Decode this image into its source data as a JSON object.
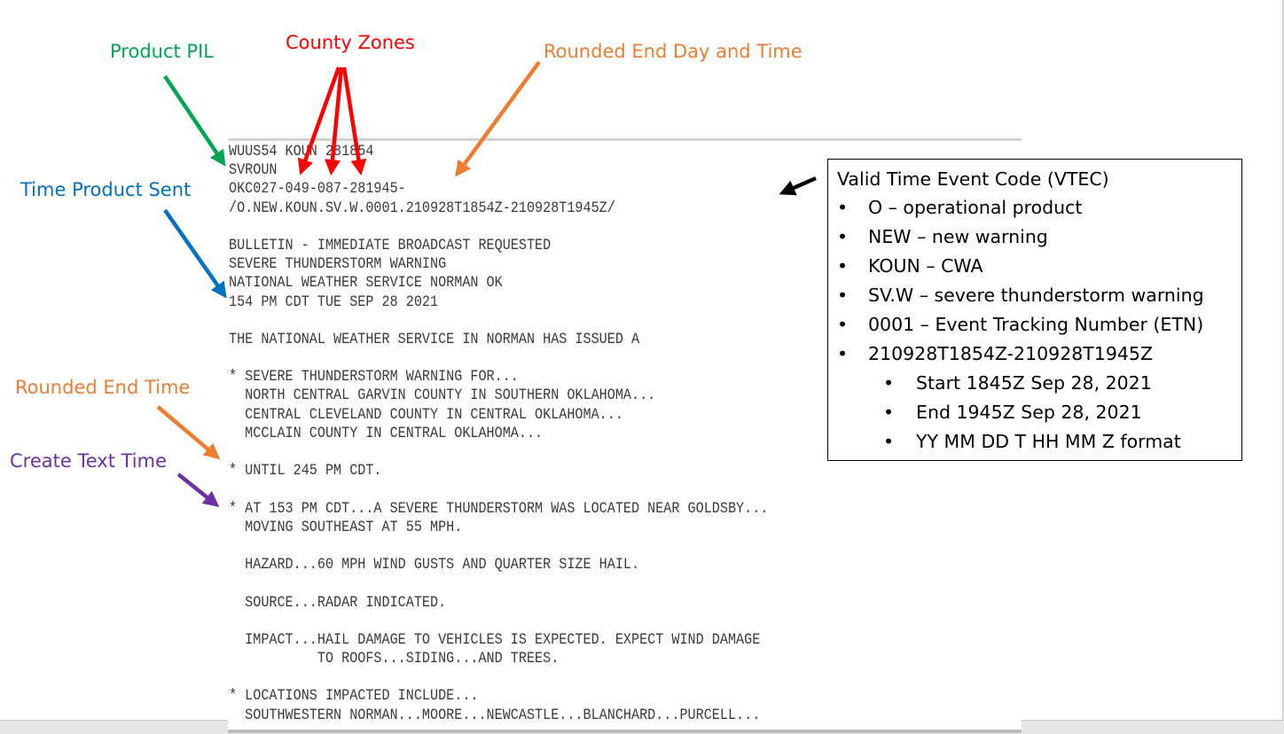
{
  "labels": {
    "product_pil": {
      "text": "Product PIL",
      "color": "#00a651"
    },
    "county_zones": {
      "text": "County Zones",
      "color": "#ff0000"
    },
    "rounded_end_day_time": {
      "text": "Rounded End Day and Time",
      "color": "#ed7d31"
    },
    "time_product_sent": {
      "text": "Time Product Sent",
      "color": "#0070c0"
    },
    "rounded_end_time": {
      "text": "Rounded End Time",
      "color": "#ed7d31"
    },
    "create_text_time": {
      "text": "Create Text Time",
      "color": "#7030a0"
    }
  },
  "document": {
    "lines": [
      "WUUS54 KOUN 281854",
      "SVROUN",
      "OKC027-049-087-281945-",
      "/O.NEW.KOUN.SV.W.0001.210928T1854Z-210928T1945Z/",
      "",
      "BULLETIN - IMMEDIATE BROADCAST REQUESTED",
      "SEVERE THUNDERSTORM WARNING",
      "NATIONAL WEATHER SERVICE NORMAN OK",
      "154 PM CDT TUE SEP 28 2021",
      "",
      "THE NATIONAL WEATHER SERVICE IN NORMAN HAS ISSUED A",
      "",
      "* SEVERE THUNDERSTORM WARNING FOR...",
      "  NORTH CENTRAL GARVIN COUNTY IN SOUTHERN OKLAHOMA...",
      "  CENTRAL CLEVELAND COUNTY IN CENTRAL OKLAHOMA...",
      "  MCCLAIN COUNTY IN CENTRAL OKLAHOMA...",
      "",
      "* UNTIL 245 PM CDT.",
      "",
      "* AT 153 PM CDT...A SEVERE THUNDERSTORM WAS LOCATED NEAR GOLDSBY...",
      "  MOVING SOUTHEAST AT 55 MPH.",
      "",
      "  HAZARD...60 MPH WIND GUSTS AND QUARTER SIZE HAIL.",
      "",
      "  SOURCE...RADAR INDICATED.",
      "",
      "  IMPACT...HAIL DAMAGE TO VEHICLES IS EXPECTED. EXPECT WIND DAMAGE",
      "           TO ROOFS...SIDING...AND TREES.",
      "",
      "* LOCATIONS IMPACTED INCLUDE...",
      "  SOUTHWESTERN NORMAN...MOORE...NEWCASTLE...BLANCHARD...PURCELL..."
    ]
  },
  "vtec_box": {
    "title": "Valid Time Event Code (VTEC)",
    "bullet": "•",
    "items": [
      "O – operational product",
      "NEW – new warning",
      "KOUN – CWA",
      "SV.W – severe thunderstorm warning",
      "0001 – Event Tracking Number (ETN)",
      "210928T1854Z-210928T1945Z"
    ],
    "sub_items": [
      "Start 1845Z Sep 28, 2021",
      "End 1945Z Sep 28, 2021",
      "YY MM DD T HH MM Z format"
    ]
  }
}
